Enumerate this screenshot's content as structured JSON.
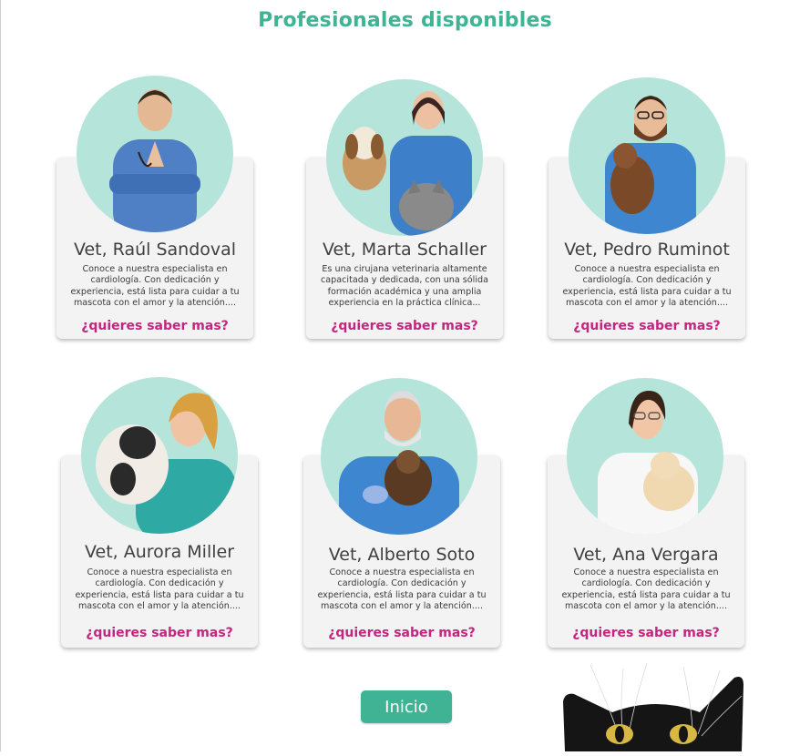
{
  "page": {
    "title": "Profesionales disponibles"
  },
  "vets": [
    {
      "name": "Vet,  Raúl Sandoval",
      "description": "Conoce a nuestra especialista en cardiología. Con dedicación y experiencia, está lista para cuidar a tu mascota con el amor y la atención....",
      "more": "¿quieres saber mas?",
      "photo": "vet-man-arms-crossed"
    },
    {
      "name": "Vet,  Marta Schaller",
      "description": "Es una cirujana veterinaria altamente capacitada y dedicada, con una sólida formación académica y una amplia experiencia en la práctica clínica...",
      "more": "¿quieres saber mas?",
      "photo": "vet-woman-with-dog-and-cat"
    },
    {
      "name": "Vet, Pedro Ruminot",
      "description": "Conoce a nuestra especialista en cardiología. Con dedicación y experiencia, está lista para cuidar a tu mascota con el amor y la atención....",
      "more": "¿quieres saber mas?",
      "photo": "vet-man-with-dog"
    },
    {
      "name": "Vet,  Aurora Miller",
      "description": "Conoce a nuestra especialista en cardiología. Con dedicación y experiencia, está lista para cuidar a tu mascota con el amor y la atención....",
      "more": "¿quieres saber mas?",
      "photo": "vet-woman-hugging-bulldog"
    },
    {
      "name": "Vet,  Alberto Soto",
      "description": "Conoce a nuestra especialista en cardiología. Con dedicación y experiencia, está lista para cuidar a tu mascota con el amor y la atención....",
      "more": "¿quieres saber mas?",
      "photo": "vet-older-man-with-puppy"
    },
    {
      "name": "Vet,  Ana Vergara",
      "description": "Conoce a nuestra especialista en cardiología. Con dedicación y experiencia, está lista para cuidar a tu mascota con el amor y la atención....",
      "more": "¿quieres saber mas?",
      "photo": "vet-woman-with-puppy"
    }
  ],
  "footer": {
    "button_label": "Inicio",
    "decoration": "black-cat-peeking"
  },
  "colors": {
    "accent": "#3fb394",
    "link": "#c3257f",
    "avatar_bg": "#b5e4da",
    "card_bg": "#f3f3f3"
  }
}
